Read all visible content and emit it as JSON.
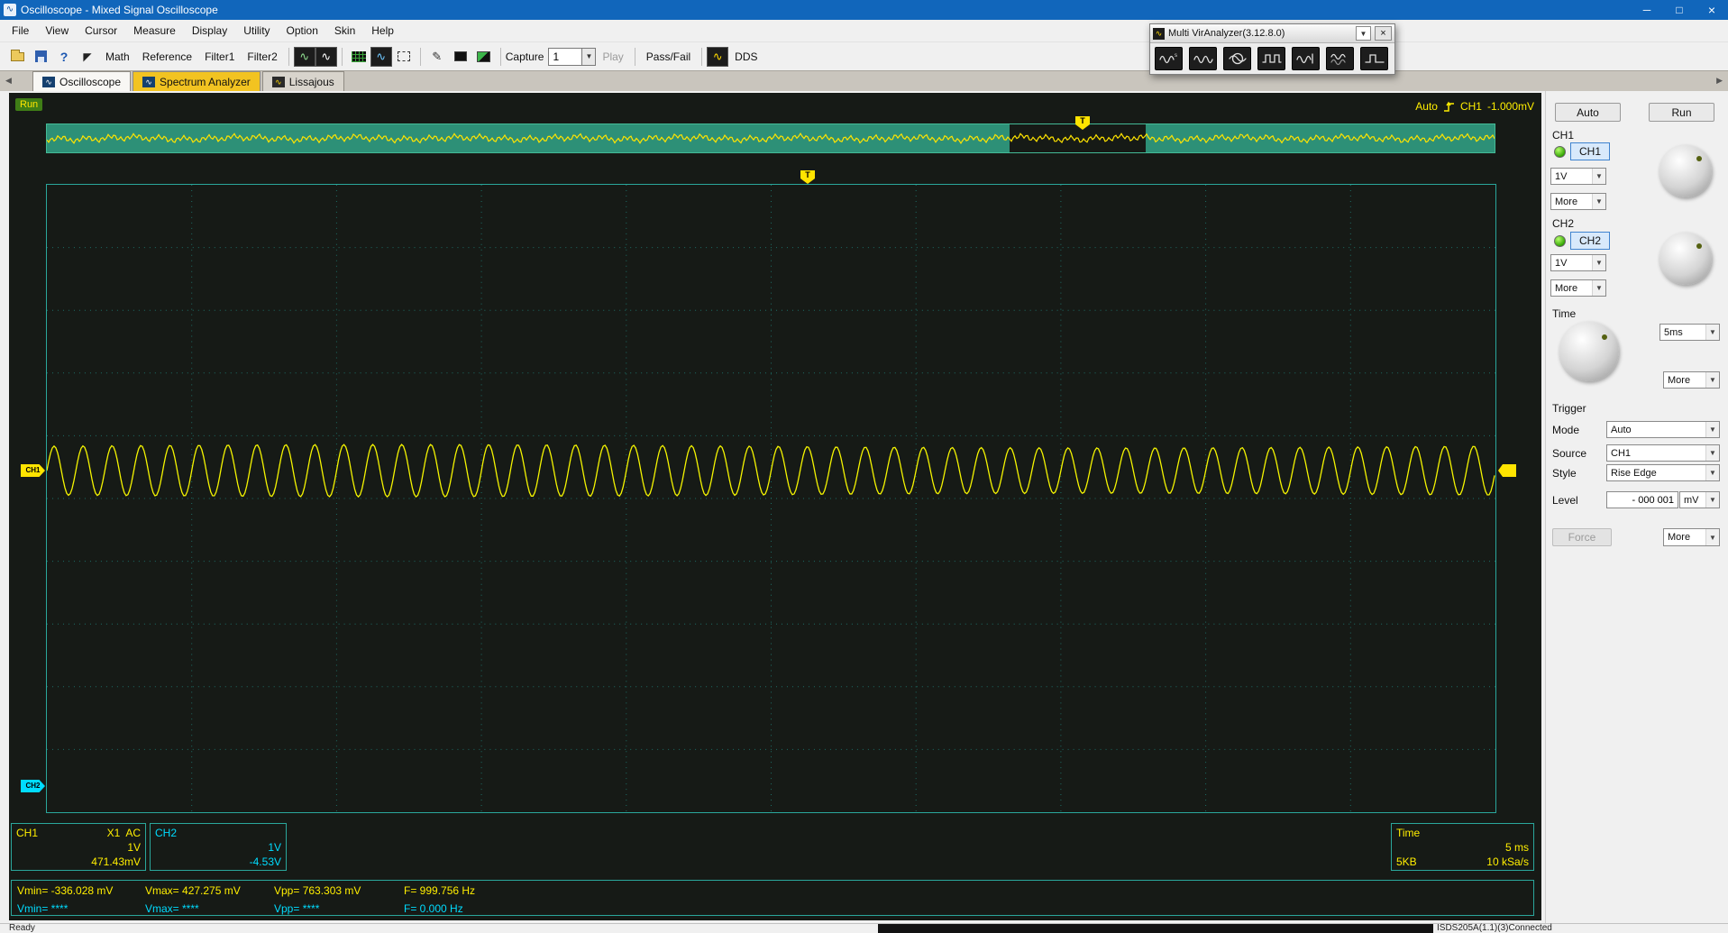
{
  "window": {
    "title": "Oscilloscope - Mixed Signal Oscilloscope",
    "status_left": "Ready",
    "status_right": "ISDS205A(1.1)(3)Connected"
  },
  "menu": {
    "items": [
      "File",
      "View",
      "Cursor",
      "Measure",
      "Display",
      "Utility",
      "Option",
      "Skin",
      "Help"
    ]
  },
  "toolbar": {
    "math": "Math",
    "reference": "Reference",
    "filter1": "Filter1",
    "filter2": "Filter2",
    "capture_label": "Capture",
    "capture_value": "1",
    "play_label": "Play",
    "passfail_label": "Pass/Fail",
    "dds_label": "DDS"
  },
  "analyzer": {
    "title": "Multi VirAnalyzer(3.12.8.0)"
  },
  "tabs": {
    "oscilloscope": "Oscilloscope",
    "spectrum": "Spectrum Analyzer",
    "lissajous": "Lissajous"
  },
  "scope": {
    "run_badge": "Run",
    "trigger_mode": "Auto",
    "trigger_source": "CH1",
    "trigger_level": "-1.000mV",
    "ch1_marker": "CH1",
    "ch2_marker": "CH2",
    "trigger_marker": "T"
  },
  "panels": {
    "ch1": {
      "title": "CH1",
      "mode": "X1  AC",
      "scale": "1V",
      "offset": "471.43mV"
    },
    "ch2": {
      "title": "CH2",
      "scale": "1V",
      "offset": "-4.53V"
    },
    "time": {
      "title": "Time",
      "scale": "5 ms",
      "depth": "5KB",
      "sample_rate": "10 kSa/s"
    },
    "measure": {
      "ch1": {
        "vmin": "Vmin= -336.028 mV",
        "vmax": "Vmax= 427.275 mV",
        "vpp": "Vpp= 763.303 mV",
        "freq": "F= 999.756 Hz"
      },
      "ch2": {
        "vmin": "Vmin= ****",
        "vmax": "Vmax= ****",
        "vpp": "Vpp= ****",
        "freq": "F= 0.000 Hz"
      }
    }
  },
  "sidebar": {
    "auto_button": "Auto",
    "run_button": "Run",
    "ch1": {
      "section": "CH1",
      "toggle": "CH1",
      "scale": "1V",
      "more": "More"
    },
    "ch2": {
      "section": "CH2",
      "toggle": "CH2",
      "scale": "1V",
      "more": "More"
    },
    "time": {
      "section": "Time",
      "scale": "5ms",
      "more": "More"
    },
    "trigger": {
      "section": "Trigger",
      "mode_label": "Mode",
      "mode": "Auto",
      "source_label": "Source",
      "source": "CH1",
      "style_label": "Style",
      "style": "Rise Edge",
      "level_label": "Level",
      "level_value": "- 000 001",
      "level_unit": "mV",
      "force_button": "Force",
      "more": "More"
    }
  },
  "chart_data": {
    "type": "line",
    "title": "CH1 live trace",
    "x_unit": "ms",
    "x_range": [
      0,
      50
    ],
    "time_per_div": "5 ms",
    "volts_per_div": "1V",
    "frequency_hz": 999.756,
    "vpp_mv": 763.303,
    "vmin_mv": -336.028,
    "vmax_mv": 427.275,
    "cycles_visible": 50,
    "series": [
      {
        "name": "CH1",
        "color": "#f5f500",
        "waveform": "sine"
      }
    ]
  }
}
